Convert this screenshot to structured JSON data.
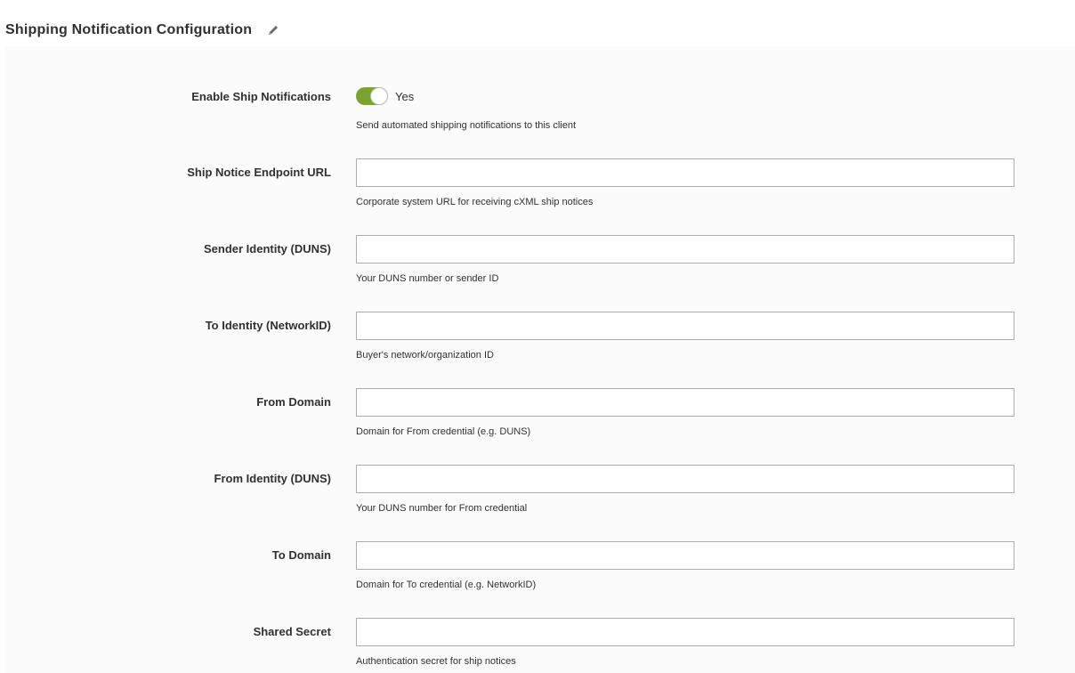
{
  "section": {
    "title": "Shipping Notification Configuration",
    "edit_icon": "pencil-icon"
  },
  "enable_ship_notifications": {
    "label": "Enable Ship Notifications",
    "enabled": true,
    "state_text": "Yes",
    "note": "Send automated shipping notifications to this client",
    "toggle_color": "#79a22e"
  },
  "fields": {
    "endpoint_url": {
      "label": "Ship Notice Endpoint URL",
      "value": "",
      "note": "Corporate system URL for receiving cXML ship notices"
    },
    "sender_identity": {
      "label": "Sender Identity (DUNS)",
      "value": "",
      "note": "Your DUNS number or sender ID"
    },
    "to_identity": {
      "label": "To Identity (NetworkID)",
      "value": "",
      "note": "Buyer's network/organization ID"
    },
    "from_domain": {
      "label": "From Domain",
      "value": "",
      "note": "Domain for From credential (e.g. DUNS)"
    },
    "from_identity": {
      "label": "From Identity (DUNS)",
      "value": "",
      "note": "Your DUNS number for From credential"
    },
    "to_domain": {
      "label": "To Domain",
      "value": "",
      "note": "Domain for To credential (e.g. NetworkID)"
    },
    "shared_secret": {
      "label": "Shared Secret",
      "value": "",
      "note": "Authentication secret for ship notices"
    }
  }
}
